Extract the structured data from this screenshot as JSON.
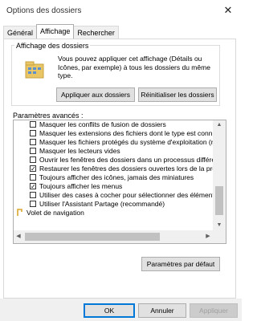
{
  "window": {
    "title": "Options des dossiers",
    "close_glyph": "✕"
  },
  "tabs": [
    {
      "label": "Général",
      "active": false
    },
    {
      "label": "Affichage",
      "active": true
    },
    {
      "label": "Rechercher",
      "active": false
    }
  ],
  "folder_view": {
    "legend": "Affichage des dossiers",
    "description": "Vous pouvez appliquer cet affichage (Détails ou Icônes, par exemple) à tous les dossiers du même type.",
    "apply_button": "Appliquer aux dossiers",
    "reset_button": "Réinitialiser les dossiers"
  },
  "advanced": {
    "label": "Paramètres avancés :",
    "items": [
      {
        "label": "Masquer les conflits de fusion de dossiers",
        "type": "checkbox",
        "checked": false
      },
      {
        "label": "Masquer les extensions des fichiers dont le type est conn",
        "type": "checkbox",
        "checked": false
      },
      {
        "label": "Masquer les fichiers protégés du système d'exploitation (r",
        "type": "checkbox",
        "checked": false
      },
      {
        "label": "Masquer les lecteurs vides",
        "type": "checkbox",
        "checked": false
      },
      {
        "label": "Ouvrir les fenêtres des dossiers dans un processus différe",
        "type": "checkbox",
        "checked": false
      },
      {
        "label": "Restaurer les fenêtres des dossiers ouvertes lors de la pro",
        "type": "checkbox",
        "checked": true
      },
      {
        "label": "Toujours afficher des icônes, jamais des miniatures",
        "type": "checkbox",
        "checked": false
      },
      {
        "label": "Toujours afficher les menus",
        "type": "checkbox",
        "checked": true
      },
      {
        "label": "Utiliser des cases à cocher pour sélectionner des élément",
        "type": "checkbox",
        "checked": false
      },
      {
        "label": "Utiliser l'Assistant Partage (recommandé)",
        "type": "checkbox",
        "checked": false
      },
      {
        "label": "Volet de navigation",
        "type": "node",
        "checked": false
      }
    ],
    "default_button": "Paramètres par défaut"
  },
  "footer": {
    "ok": "OK",
    "cancel": "Annuler",
    "apply": "Appliquer"
  },
  "icons": {
    "close": "close-icon",
    "folder": "folder-icon",
    "navigation_node": "navigation-pane-icon",
    "scroll_up": "▲",
    "scroll_down": "▼",
    "scroll_left": "◀",
    "scroll_right": "▶"
  },
  "colors": {
    "focus_accent": "#0078d7",
    "button_face": "#e1e1e1",
    "folder": "#e8c565"
  }
}
